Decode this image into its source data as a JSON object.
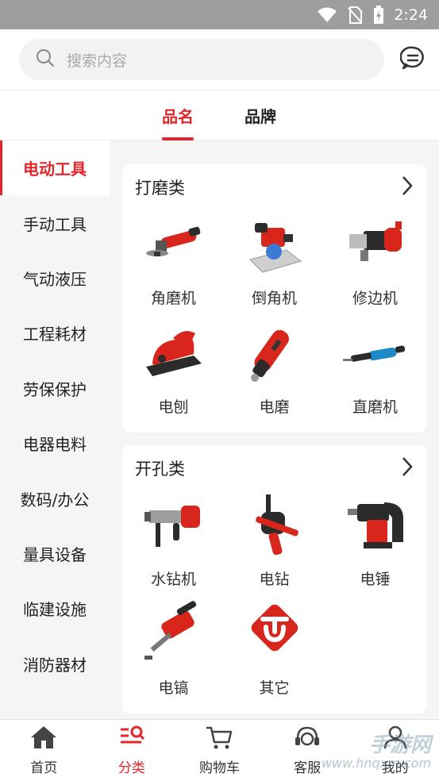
{
  "status": {
    "time": "2:24"
  },
  "search": {
    "placeholder": "搜索内容"
  },
  "tabs": [
    {
      "label": "品名"
    },
    {
      "label": "品牌"
    }
  ],
  "sidebar": {
    "items": [
      {
        "label": "电动工具"
      },
      {
        "label": "手动工具"
      },
      {
        "label": "气动液压"
      },
      {
        "label": "工程耗材"
      },
      {
        "label": "劳保保护"
      },
      {
        "label": "电器电料"
      },
      {
        "label": "数码/办公"
      },
      {
        "label": "量具设备"
      },
      {
        "label": "临建设施"
      },
      {
        "label": "消防器材"
      }
    ]
  },
  "sections": [
    {
      "title": "打磨类",
      "items": [
        {
          "label": "角磨机",
          "icon": "angle-grinder-icon"
        },
        {
          "label": "倒角机",
          "icon": "chamfering-machine-icon"
        },
        {
          "label": "修边机",
          "icon": "trimmer-icon"
        },
        {
          "label": "电刨",
          "icon": "electric-planer-icon"
        },
        {
          "label": "电磨",
          "icon": "die-grinder-icon"
        },
        {
          "label": "直磨机",
          "icon": "straight-grinder-icon"
        }
      ]
    },
    {
      "title": "开孔类",
      "items": [
        {
          "label": "水钻机",
          "icon": "core-drill-icon"
        },
        {
          "label": "电钻",
          "icon": "electric-drill-icon"
        },
        {
          "label": "电锤",
          "icon": "rotary-hammer-icon"
        },
        {
          "label": "电镐",
          "icon": "demolition-hammer-icon"
        },
        {
          "label": "其它",
          "icon": "brand-logo-icon"
        }
      ]
    }
  ],
  "nav": {
    "items": [
      {
        "label": "首页",
        "icon": "home-icon"
      },
      {
        "label": "分类",
        "icon": "category-icon"
      },
      {
        "label": "购物车",
        "icon": "cart-icon"
      },
      {
        "label": "客服",
        "icon": "customer-service-icon"
      },
      {
        "label": "我的",
        "icon": "profile-icon"
      }
    ]
  },
  "watermark": {
    "text": "手游网",
    "url": "www.hnqxm.com"
  },
  "colors": {
    "accent": "#e4252b",
    "tool_red": "#d9261c",
    "tool_dark": "#2b2b2b"
  }
}
